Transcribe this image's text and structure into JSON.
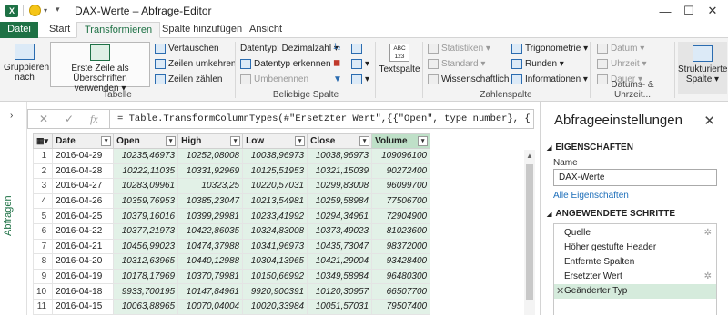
{
  "window": {
    "logo": "X",
    "title": "DAX-Werte – Abfrage-Editor",
    "minimize": "—",
    "maximize": "☐",
    "close": "✕"
  },
  "tabs": [
    "Datei",
    "Start",
    "Transformieren",
    "Spalte hinzufügen",
    "Ansicht"
  ],
  "ribbon": {
    "table_group": {
      "label": "Tabelle",
      "group_by": "Gruppieren nach",
      "first_row": "Erste Zeile als Überschriften verwenden",
      "transpose": "Vertauschen",
      "reverse": "Zeilen umkehren",
      "count": "Zeilen zählen"
    },
    "any_col_group": {
      "label": "Beliebige Spalte",
      "datatype": "Datentyp: Dezimalzahl",
      "detect": "Datentyp erkennen",
      "rename": "Umbenennen"
    },
    "text_col": {
      "label": "Textspalte",
      "icon_text": "ABC 123"
    },
    "number_group": {
      "label": "Zahlenspalte",
      "stats": "Statistiken",
      "standard": "Standard",
      "scientific": "Wissenschaftlich",
      "trig": "Trigonometrie",
      "round": "Runden",
      "info": "Informationen"
    },
    "datetime_group": {
      "label": "Datums- & Uhrzeit...",
      "date": "Datum",
      "time": "Uhrzeit",
      "duration": "Dauer"
    },
    "struct": {
      "label": "Strukturierte Spalte"
    }
  },
  "formula_bar": {
    "cancel": "✕",
    "accept": "✓",
    "fx": "fx",
    "text": "= Table.TransformColumnTypes(#\"Ersetzter Wert\",{{\"Open\", type number}, {\"High\", type"
  },
  "nav": {
    "label": "Abfragen",
    "toggle": "›"
  },
  "grid": {
    "columns": [
      "Date",
      "Open",
      "High",
      "Low",
      "Close",
      "Volume"
    ],
    "rows": [
      [
        "1",
        "2016-04-29",
        "10235,46973",
        "10252,08008",
        "10038,96973",
        "10038,96973",
        "109096100"
      ],
      [
        "2",
        "2016-04-28",
        "10222,11035",
        "10331,92969",
        "10125,51953",
        "10321,15039",
        "90272400"
      ],
      [
        "3",
        "2016-04-27",
        "10283,09961",
        "10323,25",
        "10220,57031",
        "10299,83008",
        "96099700"
      ],
      [
        "4",
        "2016-04-26",
        "10359,76953",
        "10385,23047",
        "10213,54981",
        "10259,58984",
        "77506700"
      ],
      [
        "5",
        "2016-04-25",
        "10379,16016",
        "10399,29981",
        "10233,41992",
        "10294,34961",
        "72904900"
      ],
      [
        "6",
        "2016-04-22",
        "10377,21973",
        "10422,86035",
        "10324,83008",
        "10373,49023",
        "81023600"
      ],
      [
        "7",
        "2016-04-21",
        "10456,99023",
        "10474,37988",
        "10341,96973",
        "10435,73047",
        "98372000"
      ],
      [
        "8",
        "2016-04-20",
        "10312,63965",
        "10440,12988",
        "10304,13965",
        "10421,29004",
        "93428400"
      ],
      [
        "9",
        "2016-04-19",
        "10178,17969",
        "10370,79981",
        "10150,66992",
        "10349,58984",
        "96480300"
      ],
      [
        "10",
        "2016-04-18",
        "9933,700195",
        "10147,84961",
        "9920,900391",
        "10120,30957",
        "66507700"
      ],
      [
        "11",
        "2016-04-15",
        "10063,88965",
        "10070,04004",
        "10020,33984",
        "10051,57031",
        "79507400"
      ]
    ]
  },
  "pane": {
    "title": "Abfrageeinstellungen",
    "close": "✕",
    "properties_header": "EIGENSCHAFTEN",
    "name_label": "Name",
    "name_value": "DAX-Werte",
    "all_props": "Alle Eigenschaften",
    "steps_header": "ANGEWENDETE SCHRITTE",
    "steps": [
      "Quelle",
      "Höher gestufte Header",
      "Entfernte Spalten",
      "Ersetzter Wert",
      "Geänderter Typ"
    ]
  }
}
